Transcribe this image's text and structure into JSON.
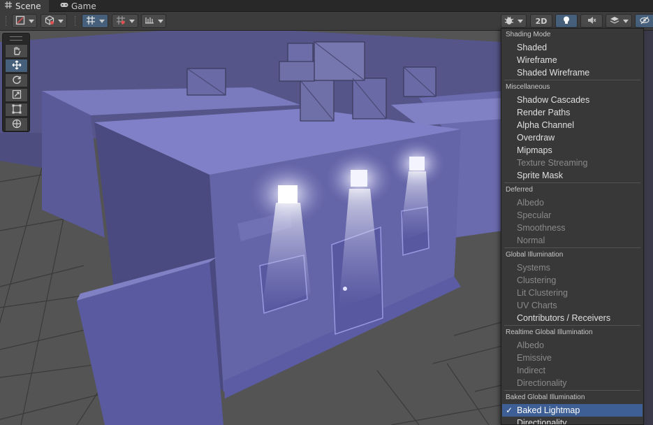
{
  "tabs": [
    {
      "label": "Scene",
      "icon": "grid-icon"
    },
    {
      "label": "Game",
      "icon": "gamepad-icon"
    }
  ],
  "toolbar": {
    "mode_2d_label": "2D"
  },
  "colors": {
    "building": "#6565a8",
    "grid_floor": "#545454",
    "menu_bg": "#383838",
    "selected": "#3e5f96",
    "active_button": "#46607c"
  },
  "menu": {
    "sections": [
      {
        "header": "Shading Mode",
        "items": [
          {
            "label": "Shaded",
            "enabled": true
          },
          {
            "label": "Wireframe",
            "enabled": true
          },
          {
            "label": "Shaded Wireframe",
            "enabled": true
          }
        ]
      },
      {
        "header": "Miscellaneous",
        "items": [
          {
            "label": "Shadow Cascades",
            "enabled": true
          },
          {
            "label": "Render Paths",
            "enabled": true
          },
          {
            "label": "Alpha Channel",
            "enabled": true
          },
          {
            "label": "Overdraw",
            "enabled": true
          },
          {
            "label": "Mipmaps",
            "enabled": true
          },
          {
            "label": "Texture Streaming",
            "enabled": false
          },
          {
            "label": "Sprite Mask",
            "enabled": true
          }
        ]
      },
      {
        "header": "Deferred",
        "items": [
          {
            "label": "Albedo",
            "enabled": false
          },
          {
            "label": "Specular",
            "enabled": false
          },
          {
            "label": "Smoothness",
            "enabled": false
          },
          {
            "label": "Normal",
            "enabled": false
          }
        ]
      },
      {
        "header": "Global Illumination",
        "items": [
          {
            "label": "Systems",
            "enabled": false
          },
          {
            "label": "Clustering",
            "enabled": false
          },
          {
            "label": "Lit Clustering",
            "enabled": false
          },
          {
            "label": "UV Charts",
            "enabled": false
          },
          {
            "label": "Contributors / Receivers",
            "enabled": true
          }
        ]
      },
      {
        "header": "Realtime Global Illumination",
        "items": [
          {
            "label": "Albedo",
            "enabled": false
          },
          {
            "label": "Emissive",
            "enabled": false
          },
          {
            "label": "Indirect",
            "enabled": false
          },
          {
            "label": "Directionality",
            "enabled": false
          }
        ]
      },
      {
        "header": "Baked Global Illumination",
        "items": [
          {
            "label": "Baked Lightmap",
            "enabled": true,
            "selected": true,
            "check": "✓"
          },
          {
            "label": "Directionality",
            "enabled": true
          }
        ]
      }
    ]
  }
}
